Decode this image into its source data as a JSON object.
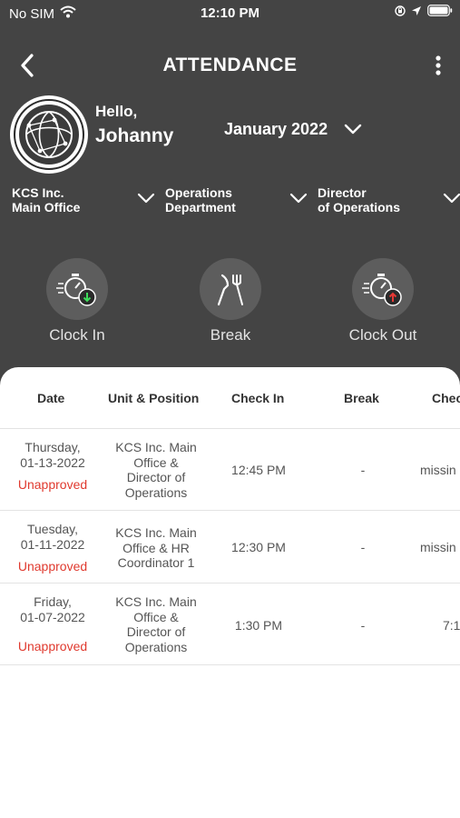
{
  "status_bar": {
    "carrier": "No SIM",
    "time": "12:10 PM"
  },
  "nav": {
    "title": "ATTENDANCE"
  },
  "user": {
    "greeting": "Hello,",
    "name": "Johanny"
  },
  "month": {
    "label": "January 2022"
  },
  "filters": [
    {
      "line1": "KCS Inc.",
      "line2": "Main Office"
    },
    {
      "line1": "Operations",
      "line2": "Department"
    },
    {
      "line1": "Director",
      "line2": "of Operations"
    }
  ],
  "actions": {
    "clock_in": "Clock In",
    "break": "Break",
    "clock_out": "Clock Out"
  },
  "table": {
    "headers": [
      "Date",
      "Unit & Position",
      "Check In",
      "Break",
      "Chec"
    ],
    "rows": [
      {
        "day": "Thursday,",
        "date": "01-13-2022",
        "status": "Unapproved",
        "unit": [
          "KCS Inc. Main",
          "Office &",
          "Director of",
          "Operations"
        ],
        "check_in": "12:45 PM",
        "break": "-",
        "check_out": "missin"
      },
      {
        "day": "Tuesday,",
        "date": "01-11-2022",
        "status": "Unapproved",
        "unit": [
          "KCS Inc. Main",
          "Office & HR",
          "Coordinator 1"
        ],
        "check_in": "12:30 PM",
        "break": "-",
        "check_out": "missin"
      },
      {
        "day": "Friday,",
        "date": "01-07-2022",
        "status": "Unapproved",
        "unit": [
          "KCS Inc. Main",
          "Office &",
          "Director of",
          "Operations"
        ],
        "check_in": "1:30 PM",
        "break": "-",
        "check_out": "7:1"
      }
    ]
  },
  "colors": {
    "header_bg": "#444444",
    "action_circle": "#5d5d5d",
    "unapproved": "#e03a2f",
    "clock_in_badge": "#3ddc5a",
    "clock_out_badge": "#e53935"
  },
  "icons": {
    "wifi": "wifi-icon",
    "location": "location-arrow-icon",
    "orientation_lock": "orientation-lock-icon",
    "battery": "battery-icon",
    "back": "chevron-left-icon",
    "more": "more-vertical-icon",
    "avatar": "globe-logo-icon",
    "dropdown": "chevron-down-icon",
    "clock_in": "stopwatch-in-icon",
    "break": "fork-knife-icon",
    "clock_out": "stopwatch-out-icon"
  }
}
